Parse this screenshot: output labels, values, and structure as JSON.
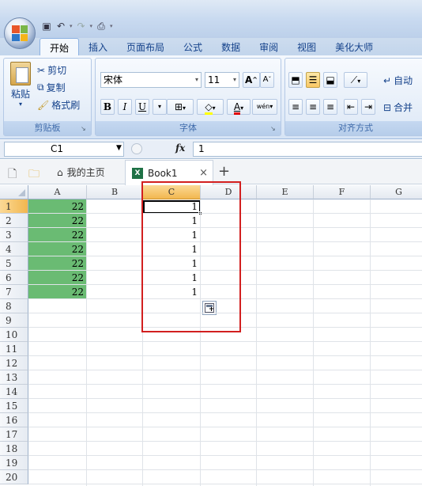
{
  "qat": {
    "icons": [
      "save-icon",
      "undo-icon",
      "redo-icon",
      "print-preview-icon",
      "customize-icon"
    ]
  },
  "tabs": [
    "开始",
    "插入",
    "页面布局",
    "公式",
    "数据",
    "审阅",
    "视图",
    "美化大师"
  ],
  "active_tab_index": 0,
  "ribbon": {
    "clipboard": {
      "paste": "粘贴",
      "cut": "剪切",
      "copy": "复制",
      "format_painter": "格式刷",
      "label": "剪贴板"
    },
    "font": {
      "font_name": "宋体",
      "font_size": "11",
      "bold": "B",
      "italic": "I",
      "underline": "U",
      "grow": "A",
      "shrink": "A",
      "font_color_letter": "A",
      "phonetic": "wén",
      "label": "字体"
    },
    "alignment": {
      "wrap": "自动",
      "merge": "合并",
      "label": "对齐方式"
    }
  },
  "formula_bar": {
    "cell_ref": "C1",
    "fx": "fx",
    "value": "1"
  },
  "doc_tabs": {
    "home": "我的主页",
    "book": "Book1",
    "book_badge": "X",
    "close": "×",
    "add": "+"
  },
  "columns": [
    "A",
    "B",
    "C",
    "D",
    "E",
    "F",
    "G"
  ],
  "selected_column": "C",
  "rows": [
    "1",
    "2",
    "3",
    "4",
    "5",
    "6",
    "7",
    "8",
    "9",
    "10",
    "11",
    "12",
    "13",
    "14",
    "15",
    "16",
    "17",
    "18",
    "19",
    "20"
  ],
  "selected_row": "1",
  "cells": {
    "A": [
      "22",
      "22",
      "22",
      "22",
      "22",
      "22",
      "22"
    ],
    "C": [
      "1",
      "1",
      "1",
      "1",
      "1",
      "1",
      "1"
    ]
  },
  "colors": {
    "accent_green": "#6abb73",
    "highlight_red": "#d21f1f",
    "selection_orange": "#f2b74f"
  }
}
